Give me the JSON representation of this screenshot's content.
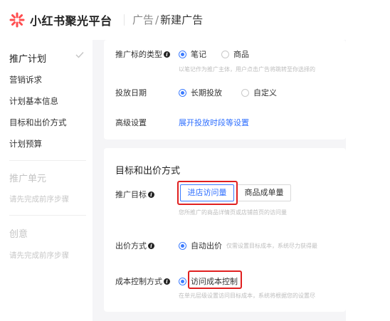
{
  "header": {
    "brand": "小红书聚光平台",
    "breadcrumb_1": "广告",
    "breadcrumb_sep": "/",
    "breadcrumb_2": "新建广告"
  },
  "sidebar": {
    "group1_title": "推广计划",
    "items": [
      "营销诉求",
      "计划基本信息",
      "目标和出价方式",
      "计划预算"
    ],
    "group2_title": "推广单元",
    "group2_hint": "请先完成前序步骤",
    "group3_title": "创意",
    "group3_hint": "请先完成前序步骤"
  },
  "basic": {
    "target_type_label": "推广标的类型",
    "target_type_options": [
      "笔记",
      "商品"
    ],
    "target_type_selected": "笔记",
    "target_type_hint": "以笔记作为推广主体，用户点击广告将跳转至你选择的",
    "schedule_label": "投放日期",
    "schedule_options": [
      "长期投放",
      "自定义"
    ],
    "schedule_selected": "长期投放",
    "advanced_label": "高级设置",
    "advanced_link": "展开投放时段等设置"
  },
  "goal": {
    "section_title": "目标和出价方式",
    "goal_label": "推广目标",
    "goal_options": [
      "进店访问量",
      "商品成单量"
    ],
    "goal_selected": "进店访问量",
    "goal_hint": "您所推广的商品详情页或店铺首页的访问量",
    "bid_label": "出价方式",
    "bid_option": "自动出价",
    "bid_hint": "仅需设置目标成本，系统尽力获得最",
    "cost_label": "成本控制方式",
    "cost_option": "访问成本控制",
    "cost_hint": "在单元层级设置访问目标成本，系统将根据您的设置尽"
  },
  "colors": {
    "accent": "#3b7bff",
    "highlight_box": "#e02020",
    "logo": "#ff4d4f"
  }
}
